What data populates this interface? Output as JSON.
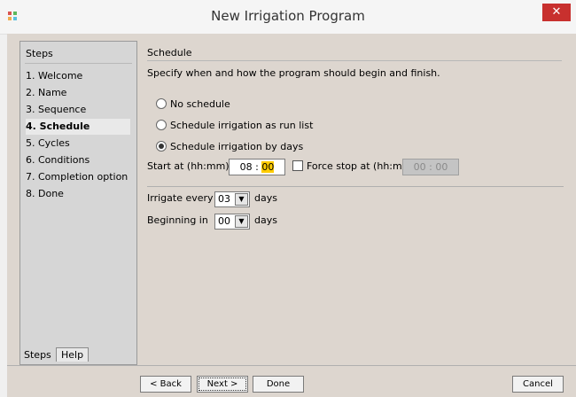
{
  "window": {
    "title": "New Irrigation Program",
    "close_glyph": "✕"
  },
  "steps_panel": {
    "title": "Steps",
    "items": [
      {
        "label": "1.  Welcome"
      },
      {
        "label": "2.  Name"
      },
      {
        "label": "3.  Sequence"
      },
      {
        "label": "4.  Schedule"
      },
      {
        "label": "5.  Cycles"
      },
      {
        "label": "6.  Conditions"
      },
      {
        "label": "7.  Completion option"
      },
      {
        "label": "8.  Done"
      }
    ],
    "active_index": 3,
    "tabs": [
      "Steps",
      "Help"
    ]
  },
  "schedule": {
    "section_title": "Schedule",
    "description": "Specify when and how the program should begin and finish.",
    "options": [
      "No schedule",
      "Schedule irrigation as run list",
      "Schedule irrigation by days"
    ],
    "selected_option": 2,
    "start_label": "Start at (hh:mm)",
    "start_hours": "08",
    "start_sep": ":",
    "start_minutes": "00",
    "force_stop_label": "Force stop at (hh:mm)",
    "force_stop_checked": false,
    "force_stop_value": "00 : 00",
    "irrigate_label": "Irrigate every",
    "irrigate_value": "03",
    "irrigate_unit": "days",
    "beginning_label": "Beginning in",
    "beginning_value": "00",
    "beginning_unit": "days"
  },
  "buttons": {
    "back": "< Back",
    "next": "Next >",
    "done": "Done",
    "cancel": "Cancel"
  },
  "colors": {
    "close": "#c8302e",
    "highlight": "#ffcc00",
    "panel_bg": "#ddd6cf"
  }
}
